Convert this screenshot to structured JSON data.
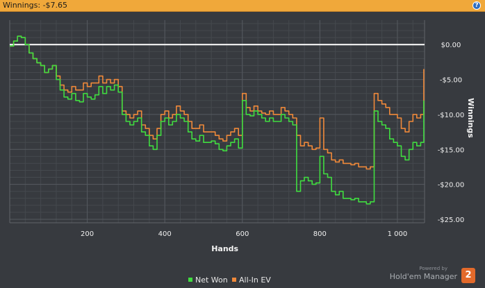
{
  "header": {
    "title": "Winnings: -$7.65",
    "help_label": "?"
  },
  "colors": {
    "net_won": "#40dd40",
    "all_in_ev": "#f0893a",
    "zero_line": "#ffffff",
    "background": "#373a3f",
    "header_bg": "#f0a83a"
  },
  "chart_data": {
    "type": "line",
    "xlabel": "Hands",
    "ylabel": "Winnings",
    "xlim": [
      0,
      1070
    ],
    "ylim": [
      -25.5,
      3.5
    ],
    "x_ticks": [
      200,
      400,
      600,
      800,
      1000
    ],
    "x_tick_labels": [
      "200",
      "400",
      "600",
      "800",
      "1 000"
    ],
    "y_ticks": [
      0,
      -5,
      -10,
      -15,
      -20,
      -25
    ],
    "y_tick_labels": [
      "$0.00",
      "-$5.00",
      "-$10.00",
      "-$15.00",
      "-$20.00",
      "-$25.00"
    ],
    "grid": true,
    "legend_position": "bottom-center",
    "series": [
      {
        "name": "Net Won",
        "color": "#40dd40",
        "x": [
          0,
          10,
          20,
          30,
          40,
          50,
          60,
          70,
          80,
          90,
          100,
          110,
          120,
          130,
          140,
          150,
          160,
          170,
          180,
          190,
          200,
          210,
          220,
          230,
          240,
          250,
          260,
          270,
          280,
          290,
          300,
          310,
          320,
          330,
          340,
          350,
          360,
          370,
          380,
          390,
          400,
          410,
          420,
          430,
          440,
          450,
          460,
          470,
          480,
          490,
          500,
          510,
          520,
          530,
          540,
          550,
          560,
          570,
          580,
          590,
          600,
          610,
          620,
          630,
          640,
          650,
          660,
          670,
          680,
          690,
          700,
          710,
          720,
          730,
          740,
          750,
          760,
          770,
          780,
          790,
          800,
          810,
          820,
          830,
          840,
          850,
          860,
          870,
          880,
          890,
          900,
          910,
          920,
          930,
          940,
          950,
          960,
          970,
          980,
          990,
          1000,
          1010,
          1020,
          1030,
          1040,
          1050,
          1060,
          1068
        ],
        "y": [
          -0.2,
          0.5,
          1.2,
          1.0,
          0.0,
          -1.2,
          -2.0,
          -2.6,
          -3.0,
          -4.0,
          -3.5,
          -3.0,
          -5.0,
          -6.5,
          -7.5,
          -7.8,
          -7.0,
          -8.0,
          -8.2,
          -7.0,
          -7.5,
          -7.8,
          -7.2,
          -6.0,
          -7.0,
          -6.0,
          -6.5,
          -5.8,
          -6.8,
          -10.0,
          -11.0,
          -11.5,
          -11.0,
          -10.5,
          -12.5,
          -13.0,
          -14.5,
          -15.0,
          -13.0,
          -11.0,
          -10.5,
          -11.5,
          -11.0,
          -10.0,
          -10.5,
          -11.0,
          -12.5,
          -13.5,
          -13.8,
          -13.0,
          -14.0,
          -14.0,
          -13.8,
          -14.2,
          -15.0,
          -15.2,
          -14.5,
          -14.0,
          -13.5,
          -14.8,
          -8.0,
          -10.0,
          -10.2,
          -9.5,
          -10.0,
          -10.5,
          -11.0,
          -10.5,
          -11.0,
          -11.0,
          -10.0,
          -10.5,
          -11.0,
          -11.5,
          -21.0,
          -19.5,
          -19.0,
          -19.5,
          -20.0,
          -19.8,
          -16.0,
          -18.5,
          -19.0,
          -21.0,
          -21.5,
          -21.0,
          -22.0,
          -22.0,
          -22.2,
          -22.0,
          -22.5,
          -22.5,
          -22.8,
          -22.5,
          -9.5,
          -11.0,
          -11.5,
          -12.0,
          -13.5,
          -14.0,
          -14.5,
          -16.0,
          -16.5,
          -15.0,
          -14.0,
          -14.5,
          -14.0,
          -8.0
        ]
      },
      {
        "name": "All-In EV",
        "color": "#f0893a",
        "x": [
          0,
          10,
          20,
          30,
          40,
          50,
          60,
          70,
          80,
          90,
          100,
          110,
          120,
          130,
          140,
          150,
          160,
          170,
          180,
          190,
          200,
          210,
          220,
          230,
          240,
          250,
          260,
          270,
          280,
          290,
          300,
          310,
          320,
          330,
          340,
          350,
          360,
          370,
          380,
          390,
          400,
          410,
          420,
          430,
          440,
          450,
          460,
          470,
          480,
          490,
          500,
          510,
          520,
          530,
          540,
          550,
          560,
          570,
          580,
          590,
          600,
          610,
          620,
          630,
          640,
          650,
          660,
          670,
          680,
          690,
          700,
          710,
          720,
          730,
          740,
          750,
          760,
          770,
          780,
          790,
          800,
          810,
          820,
          830,
          840,
          850,
          860,
          870,
          880,
          890,
          900,
          910,
          920,
          930,
          940,
          950,
          960,
          970,
          980,
          990,
          1000,
          1010,
          1020,
          1030,
          1040,
          1050,
          1060,
          1068
        ],
        "y": [
          -0.2,
          0.5,
          1.2,
          1.0,
          0.0,
          -1.2,
          -2.0,
          -2.6,
          -3.0,
          -4.0,
          -3.5,
          -3.0,
          -4.5,
          -5.8,
          -6.5,
          -6.8,
          -6.0,
          -6.5,
          -6.5,
          -5.5,
          -6.0,
          -5.5,
          -5.5,
          -4.5,
          -5.5,
          -5.0,
          -5.5,
          -5.0,
          -6.0,
          -9.5,
          -10.0,
          -10.5,
          -10.0,
          -9.5,
          -11.5,
          -12.0,
          -13.0,
          -13.5,
          -12.0,
          -10.0,
          -9.5,
          -10.5,
          -10.0,
          -8.8,
          -9.5,
          -10.0,
          -11.0,
          -12.0,
          -12.0,
          -11.5,
          -12.5,
          -12.5,
          -12.5,
          -13.0,
          -13.5,
          -13.8,
          -13.0,
          -12.5,
          -12.0,
          -13.0,
          -7.0,
          -9.0,
          -9.5,
          -8.8,
          -9.5,
          -9.8,
          -10.0,
          -9.5,
          -10.0,
          -10.0,
          -9.0,
          -9.5,
          -10.0,
          -10.5,
          -13.0,
          -14.5,
          -14.0,
          -14.5,
          -15.0,
          -14.8,
          -10.5,
          -15.0,
          -15.5,
          -16.5,
          -16.8,
          -16.5,
          -17.0,
          -17.0,
          -17.2,
          -17.0,
          -17.5,
          -17.5,
          -17.8,
          -17.5,
          -7.0,
          -8.0,
          -8.5,
          -9.0,
          -10.0,
          -10.0,
          -10.5,
          -12.0,
          -12.5,
          -11.0,
          -10.0,
          -10.5,
          -10.0,
          -3.5
        ]
      }
    ]
  },
  "legend": {
    "net_won_label": "Net Won",
    "all_in_ev_label": "All-In EV"
  },
  "branding": {
    "powered_by": "Powered by",
    "product": "Hold'em Manager",
    "logo_text": "2"
  }
}
